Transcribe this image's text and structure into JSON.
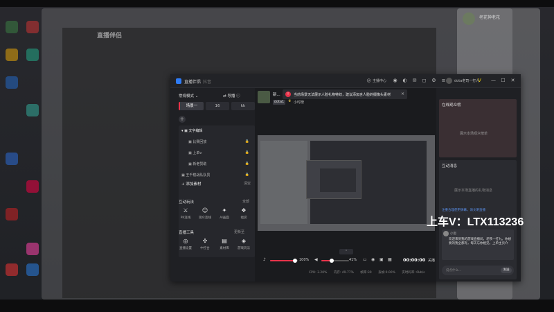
{
  "window": {
    "title": "直播伴侣",
    "subtitle": "抖音",
    "live_center": "主播中心",
    "username": "dota老司一打九",
    "controls": {
      "minimize": "—",
      "maximize": "☐",
      "close": "✕"
    }
  },
  "left": {
    "mode": "常规模式",
    "guide": "导播",
    "scenes": [
      "场景一",
      "16",
      "kk"
    ],
    "sources": [
      {
        "label": "文字编辑"
      },
      {
        "label": "比赛回放"
      },
      {
        "label": "上单v"
      },
      {
        "label": "新老赞助"
      },
      {
        "label": "王千楼战队队员"
      }
    ],
    "add_source": "添加素材",
    "clear": "清空",
    "interact": {
      "title": "互动玩法",
      "more": "全部",
      "tools": [
        "PK连线",
        "观众连线",
        "AI画面",
        "福袋"
      ]
    },
    "live_tools": {
      "title": "直播工具",
      "more": "更新至",
      "tools": [
        "直播设置",
        "中控台",
        "素材库",
        "游戏玩法"
      ]
    }
  },
  "center": {
    "title": "新...",
    "tag": "dota1",
    "tag2": "小时榜",
    "alert": "当前场景无法展示人脸礼物特效，建议添加含人脸的摄像头素材",
    "volume_pct": "100%",
    "mic_pct": "41%",
    "timer": "00:00:00",
    "close_live": "关播",
    "status": [
      "CPU: 3.20%",
      "内存: 49.77%",
      "帧率:30",
      "丢帧:0.00%",
      "实时码率: 0kb/s"
    ]
  },
  "right": {
    "online_title": "在线观众榜",
    "online_empty": "展示本场观众榜单",
    "chat_title": "互动消息",
    "chat_empty": "展示本场直播的礼物消息",
    "chat_lines": "注重合理使用弹幕，请文明直播",
    "welcome_name": "小窗",
    "welcome_text": "欢迎来到我的游戏直播间，老铁一打九。你想要的我全都有，每天与你相见。上单主页介",
    "input_placeholder": "说点什么...",
    "send": "发送"
  },
  "overlay": {
    "watermark": "上车V：LTX113236"
  },
  "bg": {
    "logo": "直播伴侣",
    "chat_name": "老花神老花"
  },
  "colors": {
    "accent": "#e8334a",
    "panel": "#1f2024"
  }
}
